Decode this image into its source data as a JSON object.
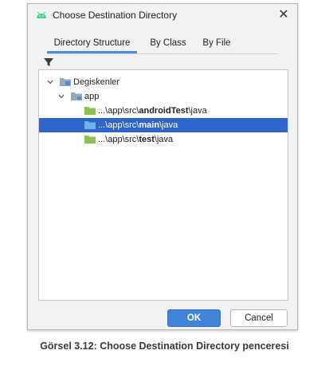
{
  "dialog": {
    "title": "Choose Destination Directory",
    "close_glyph": "✕",
    "app_icon": "android-icon"
  },
  "tabs": [
    {
      "label": "Directory Structure",
      "active": true
    },
    {
      "label": "By Class",
      "active": false
    },
    {
      "label": "By File",
      "active": false
    }
  ],
  "toolbar": {
    "filter_icon": "filter-icon"
  },
  "tree": {
    "root": {
      "label": "Degiskenler",
      "expanded": true
    },
    "module": {
      "label": "app",
      "expanded": true
    },
    "paths": [
      {
        "prefix": "...\\app\\src\\",
        "bold": "androidTest",
        "suffix": "\\java",
        "selected": false
      },
      {
        "prefix": "...\\app\\src\\",
        "bold": "main",
        "suffix": "\\java",
        "selected": true
      },
      {
        "prefix": "...\\app\\src\\",
        "bold": "test",
        "suffix": "\\java",
        "selected": false
      }
    ]
  },
  "buttons": {
    "ok": "OK",
    "cancel": "Cancel"
  },
  "colors": {
    "accent": "#3f84d8",
    "selection": "#2f65ca",
    "folder_green": "#8cc152",
    "module_blue": "#4a90d9"
  },
  "caption": "Görsel 3.12: Choose Destination Directory penceresi"
}
